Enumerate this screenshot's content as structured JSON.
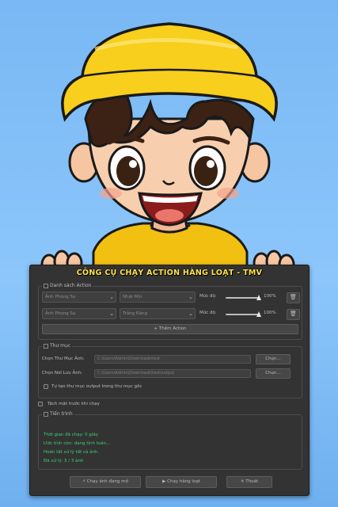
{
  "window": {
    "title": "CÔNG CỤ CHẠY ACTION HÀNG LOẠT - TMV"
  },
  "actions": {
    "group_label": "Danh sách Action",
    "rows": [
      {
        "set": "Ảnh Phóng Sự",
        "action": "Nhật Mịn",
        "level_label": "Mức độ:",
        "level_value": "100%",
        "level": 1.0
      },
      {
        "set": "Ảnh Phóng Sự",
        "action": "Trắng Răng",
        "level_label": "Mức độ:",
        "level_value": "100%",
        "level": 1.0
      }
    ],
    "add_label": "+ Thêm Action"
  },
  "folders": {
    "group_label": "Thư mục",
    "input_label": "Chọn Thư Mục Ảnh:",
    "input_path": "C:\\Users\\Admin\\Downloads\\test",
    "output_label": "Chọn Nơi Lưu Ảnh:",
    "output_path": "C:\\Users\\Admin\\Downloads\\test\\output",
    "browse_label": "Chọn...",
    "auto_output_label": "Tự tạo thư mục output trong thư mục gốc"
  },
  "options": {
    "separate_faces_label": "Tách mặt trước khi chạy"
  },
  "progress": {
    "group_label": "Tiến trình",
    "elapsed": "Thời gian đã chạy: 0 giây",
    "remaining": "Ước tính còn: đang tính toán...",
    "done": "Hoàn tất xử lý tất cả ảnh.",
    "processed": "Đã xử lý: 3 / 3 ảnh"
  },
  "buttons": {
    "run_one": "Chạy ảnh đang mở",
    "run_batch": "Chạy hàng loạt",
    "exit": "Thoát"
  },
  "colors": {
    "title": "#ffe34d",
    "status": "#3fd070",
    "panel": "#333333"
  }
}
